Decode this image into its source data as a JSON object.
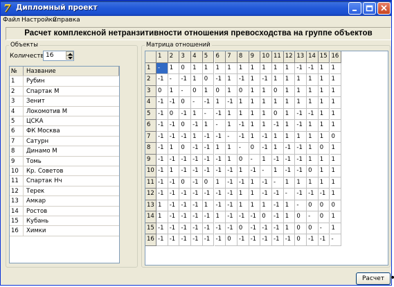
{
  "window": {
    "title": "Дипломный проект",
    "icon": "app-icon-7",
    "icon_glyph": "7"
  },
  "menu": {
    "items": [
      "Файл",
      "Настройки",
      "Справка"
    ]
  },
  "header": {
    "title": "Расчет комплексной нетранзитивности отношения превосходства на группе объектов"
  },
  "objects": {
    "legend": "Объекты",
    "count_label": "Количество:",
    "count_value": "16",
    "columns": [
      "№",
      "Название"
    ],
    "rows": [
      [
        "1",
        "Рубин"
      ],
      [
        "2",
        "Спартак М"
      ],
      [
        "3",
        "Зенит"
      ],
      [
        "4",
        "Локомотив М"
      ],
      [
        "5",
        "ЦСКА"
      ],
      [
        "6",
        "ФК Москва"
      ],
      [
        "7",
        "Сатурн"
      ],
      [
        "8",
        "Динамо М"
      ],
      [
        "9",
        "Томь"
      ],
      [
        "10",
        "Кр. Советов"
      ],
      [
        "11",
        "Спартак Нч"
      ],
      [
        "12",
        "Терек"
      ],
      [
        "13",
        "Амкар"
      ],
      [
        "14",
        "Ростов"
      ],
      [
        "15",
        "Кубань"
      ],
      [
        "16",
        "Химки"
      ]
    ]
  },
  "matrix": {
    "legend": "Матрица отношений",
    "col_headers": [
      "1",
      "2",
      "3",
      "4",
      "5",
      "6",
      "7",
      "8",
      "9",
      "10",
      "11",
      "12",
      "13",
      "14",
      "15",
      "16"
    ],
    "selected_color": "#316ac5",
    "rows": [
      [
        "-",
        "1",
        "0",
        "1",
        "1",
        "1",
        "1",
        "1",
        "1",
        "1",
        "1",
        "1",
        "-1",
        "-1",
        "1",
        "1"
      ],
      [
        "-1",
        "-",
        "-1",
        "1",
        "0",
        "-1",
        "1",
        "-1",
        "1",
        "-1",
        "1",
        "1",
        "1",
        "1",
        "1",
        "1"
      ],
      [
        "0",
        "1",
        "-",
        "0",
        "1",
        "0",
        "1",
        "0",
        "1",
        "1",
        "0",
        "1",
        "1",
        "1",
        "1",
        "1"
      ],
      [
        "-1",
        "-1",
        "0",
        "-",
        "-1",
        "1",
        "-1",
        "1",
        "1",
        "1",
        "1",
        "1",
        "1",
        "1",
        "1",
        "1"
      ],
      [
        "-1",
        "0",
        "-1",
        "1",
        "-",
        "-1",
        "1",
        "1",
        "1",
        "1",
        "0",
        "1",
        "-1",
        "-1",
        "1",
        "1"
      ],
      [
        "-1",
        "-1",
        "0",
        "-1",
        "1",
        "-",
        "1",
        "-1",
        "1",
        "1",
        "-1",
        "1",
        "-1",
        "1",
        "1",
        "1"
      ],
      [
        "-1",
        "-1",
        "-1",
        "1",
        "-1",
        "-1",
        "-",
        "-1",
        "1",
        "-1",
        "1",
        "1",
        "1",
        "1",
        "1",
        "0"
      ],
      [
        "-1",
        "1",
        "0",
        "-1",
        "-1",
        "1",
        "1",
        "-",
        "0",
        "-1",
        "1",
        "-1",
        "-1",
        "1",
        "0",
        "1"
      ],
      [
        "-1",
        "-1",
        "-1",
        "-1",
        "-1",
        "-1",
        "1",
        "0",
        "-",
        "1",
        "-1",
        "-1",
        "-1",
        "1",
        "1",
        "1"
      ],
      [
        "-1",
        "1",
        "-1",
        "-1",
        "-1",
        "-1",
        "-1",
        "1",
        "-1",
        "-",
        "1",
        "-1",
        "-1",
        "0",
        "1",
        "1"
      ],
      [
        "-1",
        "-1",
        "0",
        "-1",
        "0",
        "1",
        "-1",
        "-1",
        "1",
        "-1",
        "-",
        "1",
        "1",
        "1",
        "1",
        "1"
      ],
      [
        "-1",
        "-1",
        "-1",
        "-1",
        "-1",
        "-1",
        "-1",
        "1",
        "1",
        "-1",
        "-1",
        "-",
        "-1",
        "-1",
        "-1",
        "1"
      ],
      [
        "1",
        "-1",
        "-1",
        "-1",
        "1",
        "-1",
        "-1",
        "1",
        "1",
        "1",
        "-1",
        "1",
        "-",
        "0",
        "0",
        "0"
      ],
      [
        "1",
        "-1",
        "-1",
        "-1",
        "-1",
        "1",
        "-1",
        "-1",
        "-1",
        "0",
        "-1",
        "1",
        "0",
        "-",
        "0",
        "1"
      ],
      [
        "-1",
        "-1",
        "-1",
        "-1",
        "-1",
        "-1",
        "-1",
        "0",
        "-1",
        "-1",
        "-1",
        "1",
        "0",
        "0",
        "-",
        "1"
      ],
      [
        "-1",
        "-1",
        "-1",
        "-1",
        "-1",
        "-1",
        "0",
        "-1",
        "-1",
        "-1",
        "-1",
        "-1",
        "0",
        "-1",
        "-1",
        "-"
      ]
    ]
  },
  "actions": {
    "calc_label": "Расчет"
  }
}
